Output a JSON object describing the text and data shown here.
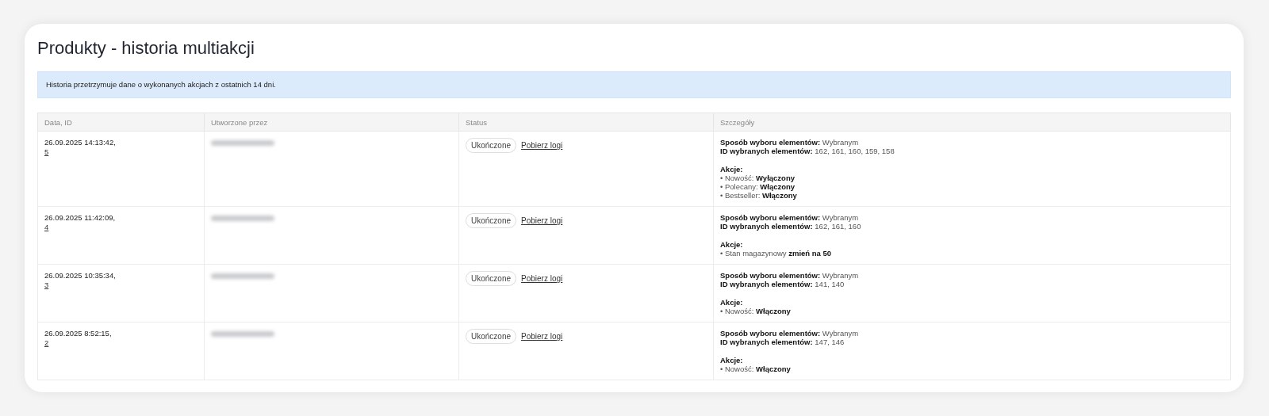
{
  "title": "Produkty - historia multiakcji",
  "info": "Historia przetrzymuje dane o wykonanych akcjach z ostatnich 14 dni.",
  "table": {
    "columns": [
      "Data, ID",
      "Utworzone przez",
      "Status",
      "Szczegóły"
    ],
    "rows": [
      {
        "date": "26.09.2025 14:13:42,",
        "id": "5",
        "created_by": {
          "redacted": true
        },
        "status": "Ukończone",
        "logs_link": "Pobierz logi",
        "details": [
          "**Sposób wyboru elementów:** Wybranym",
          "**ID wybranych elementów:** 162, 161, 160, 159, 158"
        ],
        "actions_heading": "Akcje:",
        "actions": [
          "• Nowość: **Wyłączony**",
          "• Polecany: **Włączony**",
          "• Bestseller: **Włączony**"
        ]
      },
      {
        "date": "26.09.2025 11:42:09,",
        "id": "4",
        "created_by": {
          "redacted": true
        },
        "status": "Ukończone",
        "logs_link": "Pobierz logi",
        "details": [
          "**Sposób wyboru elementów:** Wybranym",
          "**ID wybranych elementów:** 162, 161, 160"
        ],
        "actions_heading": "Akcje:",
        "actions": [
          "• Stan magazynowy **zmień na 50**"
        ]
      },
      {
        "date": "26.09.2025 10:35:34,",
        "id": "3",
        "created_by": {
          "redacted": true
        },
        "status": "Ukończone",
        "logs_link": "Pobierz logi",
        "details": [
          "**Sposób wyboru elementów:** Wybranym",
          "**ID wybranych elementów:** 141, 140"
        ],
        "actions_heading": "Akcje:",
        "actions": [
          "• Nowość: **Włączony**"
        ]
      },
      {
        "date": "26.09.2025 8:52:15,",
        "id": "2",
        "created_by": {
          "redacted": true
        },
        "status": "Ukończone",
        "logs_link": "Pobierz logi",
        "details": [
          "**Sposób wyboru elementów:** Wybranym",
          "**ID wybranych elementów:** 147, 146"
        ],
        "actions_heading": "Akcje:",
        "actions": [
          "• Nowość: **Włączony**"
        ]
      }
    ]
  }
}
